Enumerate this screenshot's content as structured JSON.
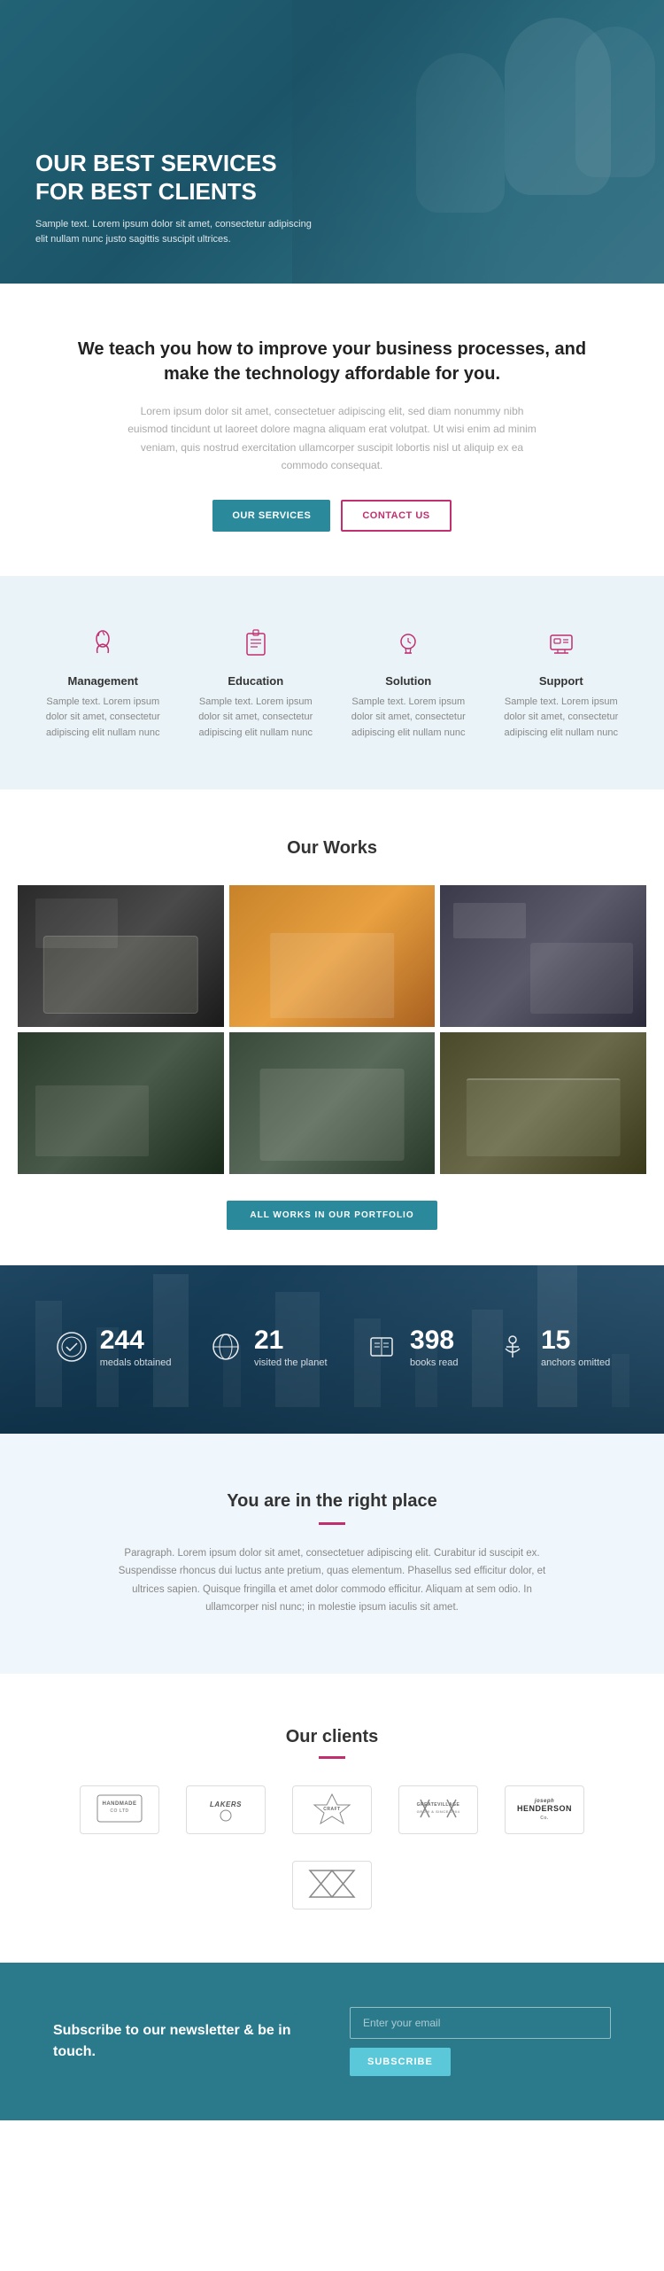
{
  "hero": {
    "title": "OUR BEST SERVICES FOR BEST CLIENTS",
    "subtitle": "Sample text. Lorem ipsum dolor sit amet, consectetur adipiscing elit nullam nunc justo sagittis suscipit ultrices."
  },
  "about": {
    "title": "We teach you how to improve your business processes, and make the technology affordable for you.",
    "text": "Lorem ipsum dolor sit amet, consectetuer adipiscing elit, sed diam nonummy nibh euismod tincidunt ut laoreet dolore magna aliquam erat volutpat. Ut wisi enim ad minim veniam, quis nostrud exercitation ullamcorper suscipit lobortis nisl ut aliquip ex ea commodo consequat.",
    "btn_services": "OUR SERVICES",
    "btn_contact": "CONTACT US"
  },
  "services": [
    {
      "icon": "🚀",
      "name": "Management",
      "desc": "Sample text. Lorem ipsum dolor sit amet, consectetur adipiscing elit nullam nunc"
    },
    {
      "icon": "📋",
      "name": "Education",
      "desc": "Sample text. Lorem ipsum dolor sit amet, consectetur adipiscing elit nullam nunc"
    },
    {
      "icon": "💡",
      "name": "Solution",
      "desc": "Sample text. Lorem ipsum dolor sit amet, consectetur adipiscing elit nullam nunc"
    },
    {
      "icon": "🖥️",
      "name": "Support",
      "desc": "Sample text. Lorem ipsum dolor sit amet, consectetur adipiscing elit nullam nunc"
    }
  ],
  "works": {
    "title": "Our Works",
    "btn_portfolio": "ALL WORKS IN OUR PORTFOLIO"
  },
  "stats": [
    {
      "icon": "⚙️",
      "number": "244",
      "label": "medals obtained"
    },
    {
      "icon": "🌍",
      "number": "21",
      "label": "visited the planet"
    },
    {
      "icon": "📚",
      "number": "398",
      "label": "books read"
    },
    {
      "icon": "⚓",
      "number": "15",
      "label": "anchors omitted"
    }
  ],
  "right_place": {
    "title": "You are in the right place",
    "text": "Paragraph. Lorem ipsum dolor sit amet, consectetuer adipiscing elit. Curabitur id suscipit ex. Suspendisse rhoncus dui luctus ante pretium, quas elementum. Phasellus sed efficitur dolor, et ultrices sapien. Quisque fringilla et amet dolor commodo efficitur. Aliquam at sem odio. In ullamcorper nisl nunc; in molestie ipsum iaculis sit amet."
  },
  "clients": {
    "title": "Our clients",
    "logos": [
      {
        "text": "HANDMADE\nCO LTD"
      },
      {
        "text": "LAKERS"
      },
      {
        "text": "★ CRAFT ★"
      },
      {
        "text": "GREATEVILLAGE\nGROW & SINCE 2004"
      },
      {
        "text": "joseph\nHENDERSON\nCo."
      },
      {
        "text": "◆"
      }
    ]
  },
  "newsletter": {
    "title": "Subscribe to our newsletter & be in touch.",
    "placeholder": "Enter your email",
    "btn_label": "SUBSCRIBE"
  }
}
